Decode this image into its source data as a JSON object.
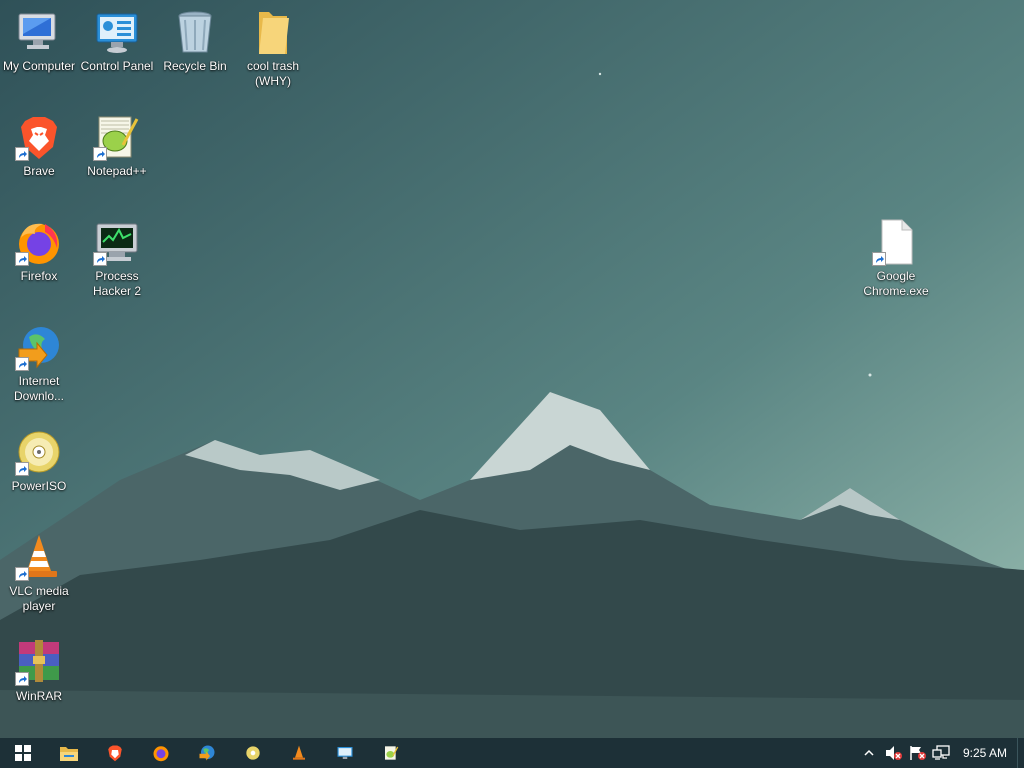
{
  "desktop": {
    "icons": [
      {
        "name": "my-computer",
        "label": "My Computer"
      },
      {
        "name": "control-panel",
        "label": "Control Panel"
      },
      {
        "name": "recycle-bin",
        "label": "Recycle Bin"
      },
      {
        "name": "cool-trash-folder",
        "label": "cool trash\n(WHY)"
      },
      {
        "name": "brave",
        "label": "Brave"
      },
      {
        "name": "notepad-plus-plus",
        "label": "Notepad++"
      },
      {
        "name": "firefox",
        "label": "Firefox"
      },
      {
        "name": "process-hacker",
        "label": "Process\nHacker 2"
      },
      {
        "name": "google-chrome-exe",
        "label": "Google\nChrome.exe"
      },
      {
        "name": "internet-download-manager",
        "label": "Internet\nDownlo..."
      },
      {
        "name": "poweriso",
        "label": "PowerISO"
      },
      {
        "name": "vlc",
        "label": "VLC media\nplayer"
      },
      {
        "name": "winrar",
        "label": "WinRAR"
      }
    ]
  },
  "taskbar": {
    "pinned": [
      "start-icon",
      "file-explorer-icon",
      "brave-icon",
      "firefox-icon",
      "internet-download-manager-icon",
      "poweriso-icon",
      "vlc-icon",
      "control-panel-icon",
      "notepad-plus-plus-icon"
    ],
    "tray": [
      "chevron-up-icon",
      "speaker-muted-icon",
      "flag-error-icon",
      "network-icon"
    ],
    "clock": "9:25 AM"
  },
  "colors": {
    "taskbar": "#1d3037",
    "sky_top": "#35595f",
    "mountain": "#2c4548"
  }
}
